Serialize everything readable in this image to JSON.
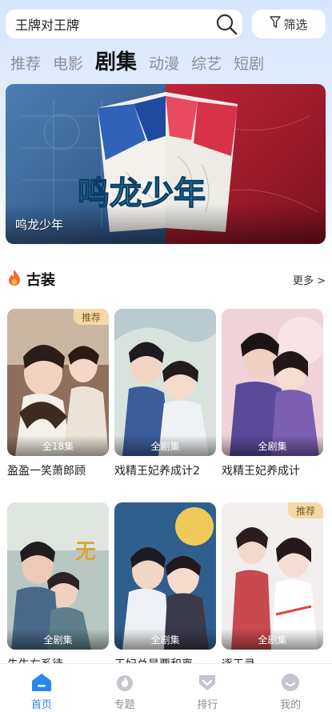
{
  "search": {
    "query": "王牌对王牌"
  },
  "filter": {
    "label": "筛选"
  },
  "tabs": [
    {
      "label": "推荐"
    },
    {
      "label": "电影"
    },
    {
      "label": "剧集"
    },
    {
      "label": "动漫"
    },
    {
      "label": "综艺"
    },
    {
      "label": "短剧"
    }
  ],
  "active_tab": "剧集",
  "banner": {
    "title": "鸣龙少年",
    "artwork_text": "鸣龙少年"
  },
  "section": {
    "title": "古装",
    "more": "更多 >"
  },
  "cards": [
    {
      "title": "盈盈一笑萧郎顾",
      "episodes": "全18集",
      "badge": "推荐"
    },
    {
      "title": "戏精王妃养成计2",
      "episodes": "全剧集",
      "badge": ""
    },
    {
      "title": "戏精王妃养成计",
      "episodes": "全剧集",
      "badge": ""
    },
    {
      "title": "先生右系待",
      "episodes": "全剧集",
      "badge": ""
    },
    {
      "title": "王妃总是要和离",
      "episodes": "全剧集",
      "badge": ""
    },
    {
      "title": "逐王录",
      "episodes": "全剧集",
      "badge": "推荐"
    }
  ],
  "nav": [
    {
      "label": "首页",
      "icon": "home-icon"
    },
    {
      "label": "专题",
      "icon": "topic-icon"
    },
    {
      "label": "排行",
      "icon": "ranking-icon"
    },
    {
      "label": "我的",
      "icon": "profile-icon"
    }
  ],
  "colors": {
    "accent": "#2a86ef",
    "badge_bg": "#f4d9a6",
    "fire": "#f26b2b"
  }
}
